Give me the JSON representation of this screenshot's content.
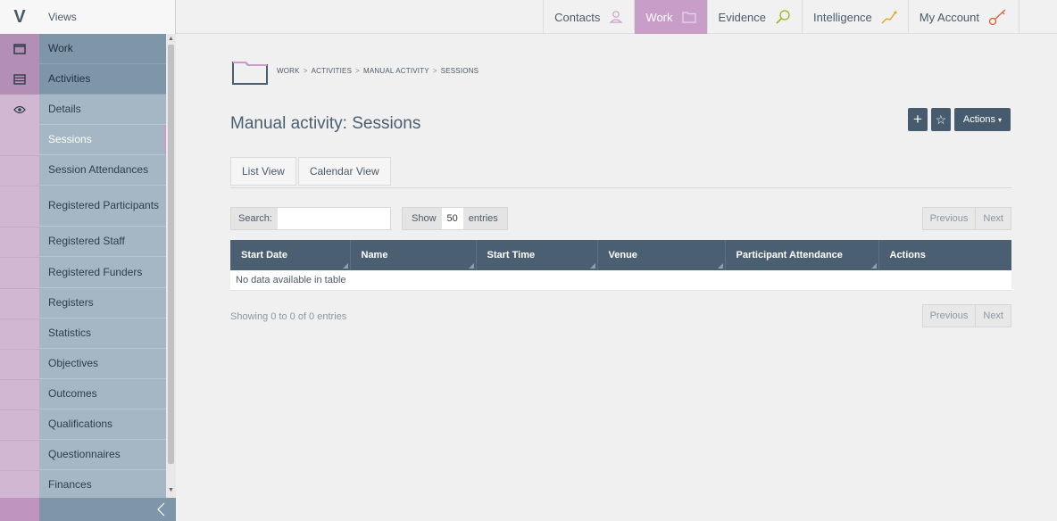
{
  "app": {
    "logo_letter": "V",
    "views_label": "Views"
  },
  "topnav": [
    {
      "label": "Contacts",
      "icon": "person-icon",
      "active": false
    },
    {
      "label": "Work",
      "icon": "folder-icon",
      "active": true
    },
    {
      "label": "Evidence",
      "icon": "magnifier-icon",
      "active": false
    },
    {
      "label": "Intelligence",
      "icon": "trend-icon",
      "active": false
    },
    {
      "label": "My Account",
      "icon": "key-icon",
      "active": false
    }
  ],
  "rail": [
    {
      "icon": "folder-icon"
    },
    {
      "icon": "list-icon"
    },
    {
      "icon": "eye-icon"
    }
  ],
  "sidebar": {
    "items": [
      {
        "label": "Work"
      },
      {
        "label": "Activities"
      },
      {
        "label": "Details"
      },
      {
        "label": "Sessions"
      },
      {
        "label": "Session Attendances"
      },
      {
        "label": "Registered Participants"
      },
      {
        "label": "Registered Staff"
      },
      {
        "label": "Registered Funders"
      },
      {
        "label": "Registers"
      },
      {
        "label": "Statistics"
      },
      {
        "label": "Objectives"
      },
      {
        "label": "Outcomes"
      },
      {
        "label": "Qualifications"
      },
      {
        "label": "Questionnaires"
      },
      {
        "label": "Finances"
      }
    ],
    "collapse_glyph": "〈"
  },
  "breadcrumb": {
    "items": [
      "WORK",
      "ACTIVITIES",
      "MANUAL ACTIVITY",
      "SESSIONS"
    ],
    "separator": ">"
  },
  "page": {
    "title": "Manual activity: Sessions"
  },
  "toolbar": {
    "add_glyph": "+",
    "star_glyph": "☆",
    "actions_label": "Actions",
    "actions_caret": "▾"
  },
  "tabs": [
    {
      "label": "List View",
      "active": true
    },
    {
      "label": "Calendar View",
      "active": false
    }
  ],
  "search": {
    "label": "Search:",
    "value": "",
    "placeholder": ""
  },
  "show": {
    "label": "Show",
    "value": "50",
    "suffix": "entries"
  },
  "pager": {
    "previous": "Previous",
    "next": "Next"
  },
  "table": {
    "columns": [
      "Start Date",
      "Name",
      "Start Time",
      "Venue",
      "Participant Attendance",
      "Actions"
    ],
    "empty_message": "No data available in table"
  },
  "info": "Showing 0 to 0 of 0 entries",
  "colors": {
    "accent": "#c89ec9",
    "header": "#4a6072",
    "sidebar": "#a5b7c5",
    "sidebar_dark": "#7f96a8"
  }
}
